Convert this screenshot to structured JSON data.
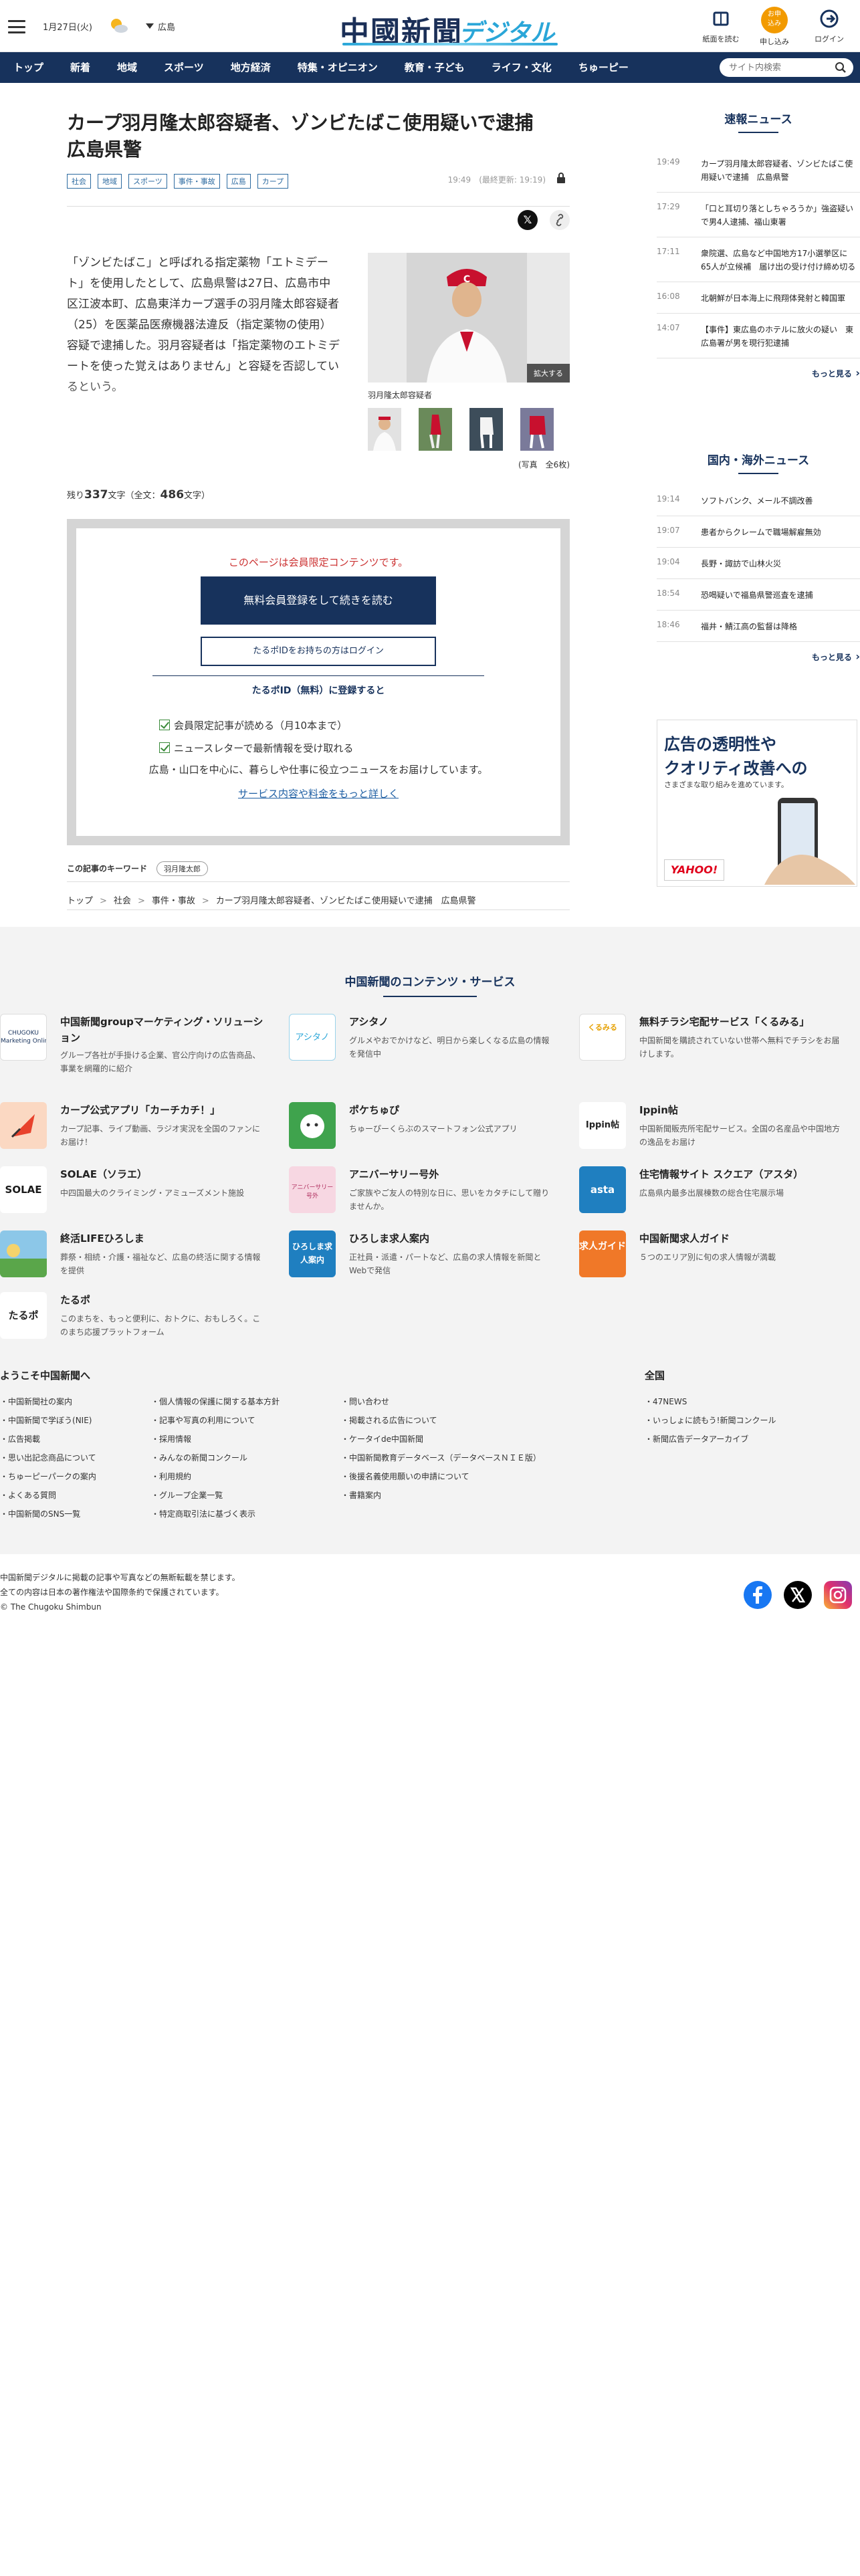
{
  "header": {
    "date": "1月27日(火)",
    "weather_icon": "sun-cloud-icon",
    "region": "広島",
    "logo_main": "中國新聞",
    "logo_sub": "デジタル",
    "buttons": [
      {
        "label": "紙面を読む",
        "icon": "newspaper-icon"
      },
      {
        "label": "申し込み",
        "icon": "signup-icon",
        "icon_text": "お申\n込み"
      },
      {
        "label": "ログイン",
        "icon": "login-icon"
      }
    ]
  },
  "nav": {
    "items": [
      "トップ",
      "新着",
      "地域",
      "スポーツ",
      "地方経済",
      "特集・オピニオン",
      "教育・子ども",
      "ライフ・文化",
      "ちゅーピー"
    ],
    "search_placeholder": "サイト内検索"
  },
  "article": {
    "title": "カープ羽月隆太郎容疑者、ゾンビたばこ使用疑いで逮捕　広島県警",
    "tags": [
      "社会",
      "地域",
      "スポーツ",
      "事件・事故",
      "広島",
      "カープ"
    ],
    "timestamp": "19:49　(最終更新: 19:19)",
    "lead": "「ゾンビたばこ」と呼ばれる指定薬物「エトミデート」を使用したとして、広島県警は27日、広島市中区江波本町、広島東洋カープ選手の羽月隆太郎容疑者（25）を医薬品医療機器法違反（指定薬物の使用）容疑で逮捕した。羽月容疑者は「指定薬物のエトミデートを使った覚えはありません」と容疑を否認しているという。",
    "photo_caption": "羽月隆太郎容疑者",
    "enlarge_label": "拡大する",
    "photo_count": "(写真　全6枚)",
    "remaining_prefix": "残り",
    "remaining_chars": "337",
    "remaining_mid": "文字（全文：",
    "total_chars": "486",
    "remaining_suffix": "文字）"
  },
  "paywall": {
    "title": "このページは会員限定コンテンツです。",
    "register_button": "無料会員登録をして続きを読む",
    "login_button": "たるポIDをお持ちの方はログイン",
    "taru_title": "たるポID（無料）に登録すると",
    "benefits": [
      "会員限定記事が読める（月10本まで）",
      "ニュースレターで最新情報を受け取れる"
    ],
    "note": "広島・山口を中心に、暮らしや仕事に役立つニュースをお届けしています。",
    "link": "サービス内容や料金をもっと詳しく"
  },
  "keywords": {
    "label": "この記事のキーワード",
    "items": [
      "羽月隆太郎"
    ]
  },
  "breadcrumb": [
    "トップ",
    "社会",
    "事件・事故",
    "カープ羽月隆太郎容疑者、ゾンビたばこ使用疑いで逮捕　広島県警"
  ],
  "sidebar": {
    "breaking_title": "速報ニュース",
    "breaking": [
      {
        "time": "19:49",
        "text": "カープ羽月隆太郎容疑者、ゾンビたばこ使用疑いで逮捕　広島県警"
      },
      {
        "time": "17:29",
        "text": "「口と耳切り落としちゃろうか」強盗疑いで男4人逮捕、福山東署"
      },
      {
        "time": "17:11",
        "text": "衆院選、広島など中国地方17小選挙区に65人が立候補　届け出の受け付け締め切る"
      },
      {
        "time": "16:08",
        "text": "北朝鮮が日本海上に飛翔体発射と韓国軍"
      },
      {
        "time": "14:07",
        "text": "【事件】東広島のホテルに放火の疑い　東広島署が男を現行犯逮捕"
      }
    ],
    "more": "もっと見る",
    "world_title": "国内・海外ニュース",
    "world": [
      {
        "time": "19:14",
        "text": "ソフトバンク、メール不調改善"
      },
      {
        "time": "19:07",
        "text": "患者からクレームで職場解雇無効"
      },
      {
        "time": "19:04",
        "text": "長野・諏訪で山林火災"
      },
      {
        "time": "18:54",
        "text": "恐喝疑いで福島県警巡査を逮捕"
      },
      {
        "time": "18:46",
        "text": "福井・鯖江高の監督は降格"
      }
    ],
    "ad": {
      "line1": "広告の透明性や",
      "line2": "クオリティ改善への",
      "sub": "さまざまな取り組みを進めています。",
      "brand": "YAHOO!"
    }
  },
  "services": {
    "title": "中国新聞のコンテンツ・サービス",
    "items": [
      {
        "name": "中国新聞groupマーケティング・ソリューション",
        "desc": "グループ各社が手掛ける企業、官公庁向けの広告商品、事業を網羅的に紹介",
        "logo_text": "CHUGOKU\nMarketing Online"
      },
      {
        "name": "アシタノ",
        "desc": "グルメやおでかけなど、明日から楽しくなる広島の情報を発信中",
        "logo_text": "アシタノ"
      },
      {
        "name": "無料チラシ宅配サービス「くるみる」",
        "desc": "中国新聞を購読されていない世帯へ無料でチラシをお届けします。",
        "logo_text": "くるみる"
      },
      {
        "name": "カープ公式アプリ「カーチカチ！」",
        "desc": "カープ記事、ライブ動画、ラジオ実況を全国のファンにお届け！",
        "logo_text": ""
      },
      {
        "name": "ポケちゅぴ",
        "desc": "ちゅーぴーくらぶのスマートフォン公式アプリ",
        "logo_text": ""
      },
      {
        "name": "Ippin帖",
        "desc": "中国新聞販売所宅配サービス。全国の名産品や中国地方の逸品をお届け",
        "logo_text": "Ippin帖"
      },
      {
        "name": "SOLAE（ソラエ）",
        "desc": "中四国最大のクライミング・アミューズメント施設",
        "logo_text": "SOLAE"
      },
      {
        "name": "アニバーサリー号外",
        "desc": "ご家族やご友人の特別な日に、思いをカタチにして贈りませんか。",
        "logo_text": "アニバーサリー号外"
      },
      {
        "name": "住宅情報サイト スクエア（アスタ）",
        "desc": "広島県内最多出展棟数の総合住宅展示場",
        "logo_text": "asta"
      },
      {
        "name": "終活LIFEひろしま",
        "desc": "葬祭・相続・介護・福祉など、広島の終活に関する情報を提供",
        "logo_text": ""
      },
      {
        "name": "ひろしま求人案内",
        "desc": "正社員・派遣・パートなど、広島の求人情報を新聞とWebで発信",
        "logo_text": "ひろしま求人案内"
      },
      {
        "name": "中国新聞求人ガイド",
        "desc": "５つのエリア別に旬の求人情報が満載",
        "logo_text": "求人ガイド"
      },
      {
        "name": "たるポ",
        "desc": "このまちを、もっと便利に、おトクに、おもしろく。このまち応援プラットフォーム",
        "logo_text": "たるポ"
      }
    ]
  },
  "welcome": {
    "title": "ようこそ中国新聞へ",
    "col1": [
      "中国新聞社の案内",
      "中国新聞で学ぼう(NIE)",
      "広告掲載",
      "思い出記念商品について",
      "ちゅーピーパークの案内",
      "よくある質問",
      "中国新聞のSNS一覧"
    ],
    "col2": [
      "個人情報の保護に関する基本方針",
      "記事や写真の利用について",
      "採用情報",
      "みんなの新聞コンクール",
      "利用規約",
      "グループ企業一覧",
      "特定商取引法に基づく表示"
    ],
    "col3": [
      "問い合わせ",
      "掲載される広告について",
      "ケータイde中国新聞",
      "中国新聞教育データベース（データベースＮＩＥ版）",
      "後援名義使用願いの申請について",
      "書籍案内"
    ],
    "national_title": "全国",
    "national": [
      "47NEWS",
      "いっしょに読もう!新聞コンクール",
      "新聞広告データアーカイブ"
    ]
  },
  "footer": {
    "lines": [
      "中国新聞デジタルに掲載の記事や写真などの無断転載を禁じます。",
      "全ての内容は日本の著作権法や国際条約で保護されています。",
      "© The Chugoku Shimbun"
    ],
    "social": [
      "facebook-icon",
      "x-icon",
      "instagram-icon"
    ]
  },
  "colors": {
    "navy": "#17325c",
    "accent_blue": "#2aa6d8",
    "alert_red": "#cc3333",
    "signup_orange": "#f29a00"
  }
}
